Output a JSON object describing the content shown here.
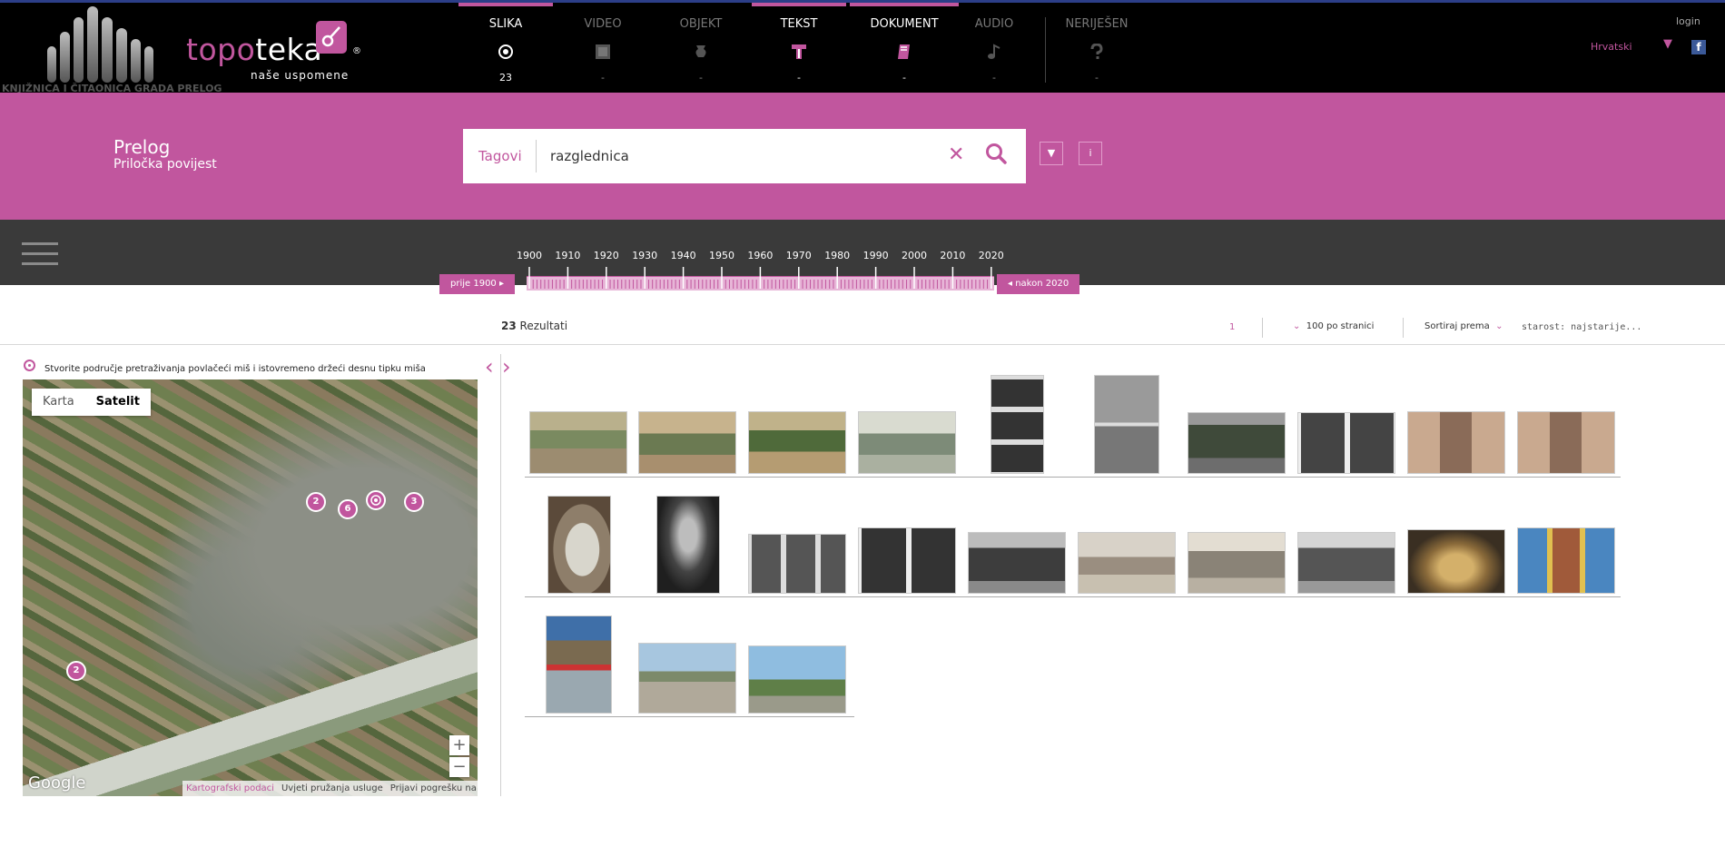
{
  "header": {
    "brand_topo": "topo",
    "brand_teka": "teka",
    "brand_reg": "®",
    "brand_sub": "naše uspomene",
    "library": "KNJIŽNICA I ČITAONICA GRADA PRELOG",
    "tabs": [
      {
        "label": "SLIKA",
        "count": "23",
        "icon": "image-circle-icon"
      },
      {
        "label": "VIDEO",
        "count": "-",
        "icon": "video-icon"
      },
      {
        "label": "OBJEKT",
        "count": "-",
        "icon": "vase-icon"
      },
      {
        "label": "TEKST",
        "count": "-",
        "icon": "text-icon"
      },
      {
        "label": "DOKUMENT",
        "count": "-",
        "icon": "document-icon"
      },
      {
        "label": "AUDIO",
        "count": "-",
        "icon": "music-note-icon"
      },
      {
        "label": "NERIJEŠEN",
        "count": "-",
        "icon": "question-icon"
      }
    ],
    "language": "Hrvatski",
    "login": "login",
    "facebook": "f"
  },
  "search": {
    "place_title": "Prelog",
    "place_sub": "Priločka povijest",
    "type_label": "Tagovi",
    "value": "razglednica",
    "clear_icon": "✕",
    "dropdown_label": "▼",
    "info_label": "i"
  },
  "timeline": {
    "years": [
      "1900",
      "1910",
      "1920",
      "1930",
      "1940",
      "1950",
      "1960",
      "1970",
      "1980",
      "1990",
      "2000",
      "2010",
      "2020"
    ],
    "before": "prije 1900",
    "after": "nakon 2020"
  },
  "results": {
    "count": "23",
    "count_label": " Rezultati",
    "page": "1",
    "per_page": "100 po stranici",
    "sort_label": "Sortiraj prema",
    "sort_value": "starost: najstarije..."
  },
  "map": {
    "hint": "Stvorite područje pretraživanja povlačeći miš i istovremeno držeći desnu tipku miša",
    "tab_map": "Karta",
    "tab_satellite": "Satelit",
    "markers": [
      "2",
      "6",
      "3",
      "2"
    ],
    "zoom_in": "+",
    "zoom_out": "−",
    "google": "Google",
    "footer": [
      "Kartografski podaci",
      "Uvjeti pružanja usluge",
      "Prijavi pogrešku na karti"
    ]
  },
  "colors": {
    "accent": "#c1569e",
    "topbar": "#000000",
    "timeline_bg": "#3a3a3a"
  }
}
